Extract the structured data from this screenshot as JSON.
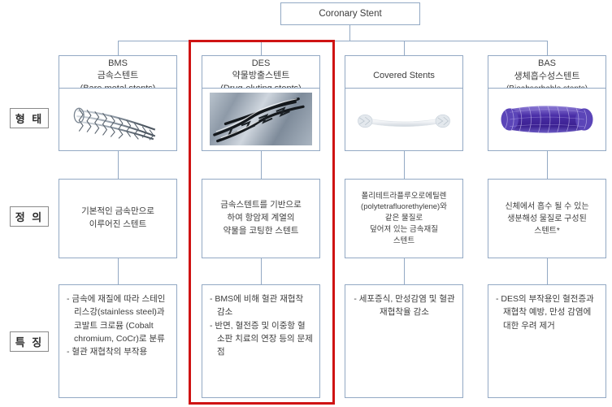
{
  "diagram": {
    "title": "Coronary Stent",
    "root_label": "Coronary Stent",
    "row_labels": {
      "shape": "형 태",
      "definition": "정 의",
      "features": "특 징"
    },
    "highlight_color": "#cf1313",
    "line_color": "#93a9c4",
    "highlighted_column": "DES"
  },
  "columns": [
    {
      "key": "bms",
      "head": {
        "abbr": "BMS",
        "korean": "금속스텐트",
        "english": "(Bare metal stents)"
      },
      "image_name": "bare-metal-stent-photo",
      "definition": [
        "기본적인 금속만으로",
        "이루어진 스텐트"
      ],
      "features": [
        "- 금속에 재질에 따라 스테인리스강(stainless steel)과 코발트 크로뮴 (Cobalt chromium, CoCr)로 분류",
        "- 혈관 재협착의 부작용"
      ],
      "highlighted": false
    },
    {
      "key": "des",
      "head": {
        "abbr": "DES",
        "korean": "약물방출스텐트",
        "english": "(Drug-eluting stents)"
      },
      "image_name": "drug-eluting-stent-photo",
      "definition": [
        "금속스텐트를 기반으로",
        "하여 항암제 계열의",
        "약물을 코팅한 스텐트"
      ],
      "features": [
        "- BMS에 비해 혈관 재협착 감소",
        "- 반면, 혈전증 및 이중항 혈소판 치료의 연장 등의 문제점"
      ],
      "highlighted": true
    },
    {
      "key": "covered",
      "head": {
        "abbr": "",
        "korean": "",
        "english": "Covered Stents"
      },
      "image_name": "covered-stent-photo",
      "definition": [
        "폴리테트라플루오로에틸렌",
        "(polytetrafluorethylene)와",
        "같은 물질로",
        "덮어져 있는 금속재질",
        "스텐트"
      ],
      "features": [
        "- 세포증식, 만성감염 및 혈관 재협착율 감소"
      ],
      "highlighted": false
    },
    {
      "key": "bas",
      "head": {
        "abbr": "BAS",
        "korean": "생체흡수성스텐트",
        "english": "(Bioabsorbable stents)"
      },
      "image_name": "bioabsorbable-stent-photo",
      "definition": [
        "신체에서 흡수 될 수 있는",
        "생분해성 물질로 구성된",
        "스텐트*"
      ],
      "features": [
        "- DES의 부작용인 혈전증과 재협착 예방, 만성 감염에 대한 우려 제거"
      ],
      "highlighted": false
    }
  ]
}
